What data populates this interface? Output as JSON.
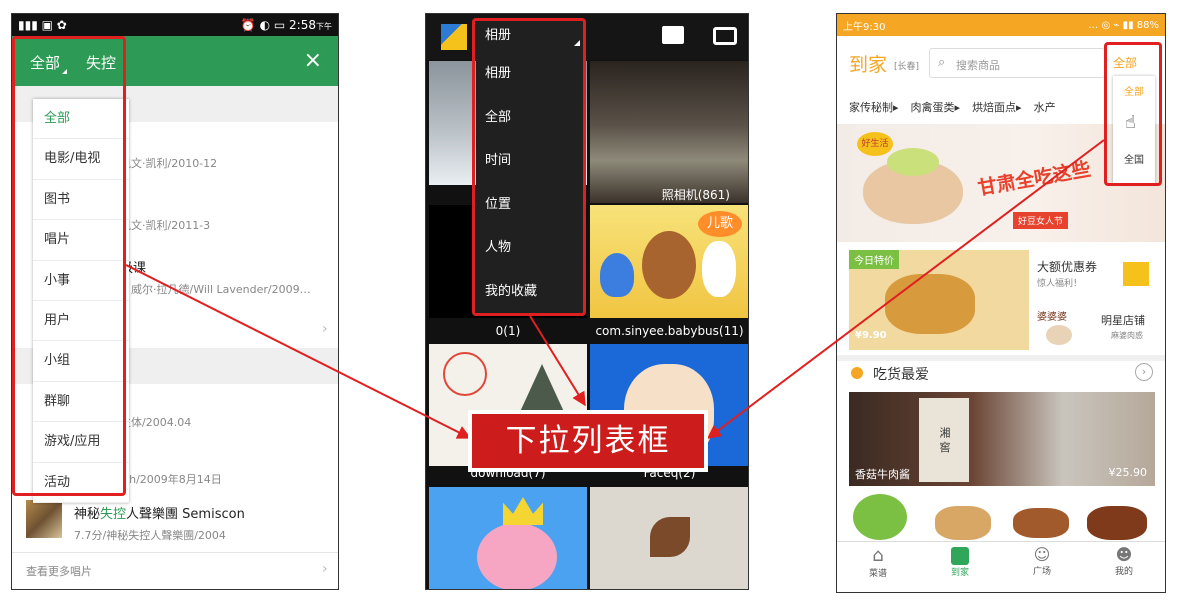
{
  "p1": {
    "status_time": "2:58",
    "status_ampm": "下午",
    "filter_all": "全部",
    "filter_lost": "失控",
    "close": "×",
    "menu": [
      "全部",
      "电影/电视",
      "图书",
      "唱片",
      "小事",
      "用户",
      "小组",
      "群聊",
      "游戏/应用",
      "活动"
    ],
    "rows": [
      "凯文·凯利/2010-12",
      "凯文·凯利/2011-3",
      "级课",
      "）威尔·拉凡德/Will Lavender/2009…",
      "生体/2004.04",
      "ich/2009年8月14日"
    ],
    "album_title_pre": "神秘",
    "album_title_hl": "失控",
    "album_title_post": "人聲樂團 Semiscon",
    "album_meta": "7.7分/神秘失控人聲樂團/2004",
    "more": "查看更多唱片"
  },
  "p2": {
    "selected": "相册",
    "menu": [
      "相册",
      "全部",
      "时间",
      "位置",
      "人物",
      "我的收藏"
    ],
    "folders": [
      "照相机(861)",
      "0(1)",
      "com.sinyee.babybus(11)"
    ],
    "kid_sticker": "儿歌",
    "kid_partial_left": "download(7)",
    "kid_partial_right": "Faceq(2)"
  },
  "p3": {
    "status_left": "上午9:30",
    "status_right": "88%",
    "brand": "到家",
    "city": "[长春]",
    "search_placeholder": "搜索商品",
    "filter_selected": "全部",
    "menu": [
      "全部",
      "",
      "全国"
    ],
    "cats": [
      "家传秘制▸",
      "肉禽蛋类▸",
      "烘焙面点▸",
      "水产"
    ],
    "banner_text": "甘肃全吃这些",
    "banner_tag": "好豆女人节",
    "banner_badge": "好生活",
    "promo_label": "今日特价",
    "promo_price": "¥9.90",
    "coupon_title": "大额优惠券",
    "coupon_sub": "惊人福利！",
    "store_logo": "婆婆婆",
    "store_title": "明星店铺",
    "store_sub": "麻婆肉惑",
    "section": "吃货最爱",
    "product": "香菇牛肉酱",
    "product_price": "¥25.90",
    "jar_text": "湘 窖",
    "tabs": [
      "菜谱",
      "到家",
      "广场",
      "我的"
    ]
  },
  "callout": "下拉列表框",
  "colors": {
    "green": "#2d9b55",
    "orange": "#f5a623",
    "red": "#e02020",
    "callout": "#cc1c1c"
  }
}
